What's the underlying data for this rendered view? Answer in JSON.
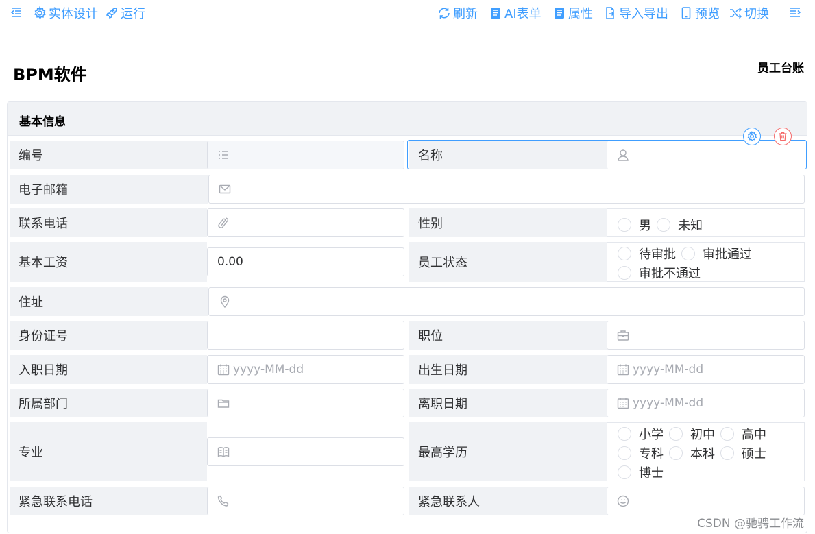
{
  "toolbar": {
    "entity_design": "实体设计",
    "run": "运行",
    "refresh": "刷新",
    "ai_form": "AI表单",
    "properties": "属性",
    "import_export": "导入导出",
    "preview": "预览",
    "switch": "切换",
    "accent_color": "#409eff"
  },
  "page": {
    "title": "BPM软件",
    "form_name": "员工台账"
  },
  "section": {
    "title": "基本信息"
  },
  "fields": {
    "number": {
      "label": "编号",
      "icon": "list-icon"
    },
    "name": {
      "label": "名称",
      "icon": "user-icon"
    },
    "email": {
      "label": "电子邮箱",
      "icon": "mail-icon"
    },
    "phone": {
      "label": "联系电话",
      "icon": "phone-icon"
    },
    "gender": {
      "label": "性别",
      "options": [
        "男",
        "未知"
      ]
    },
    "salary": {
      "label": "基本工资",
      "value": "0.00"
    },
    "status": {
      "label": "员工状态",
      "options": [
        "待审批",
        "审批通过",
        "审批不通过"
      ]
    },
    "address": {
      "label": "住址",
      "icon": "location-icon"
    },
    "id_card": {
      "label": "身份证号"
    },
    "position": {
      "label": "职位",
      "icon": "briefcase-icon"
    },
    "hire_date": {
      "label": "入职日期",
      "placeholder": "yyyy-MM-dd"
    },
    "birth_date": {
      "label": "出生日期",
      "placeholder": "yyyy-MM-dd"
    },
    "department": {
      "label": "所属部门",
      "icon": "folder-icon"
    },
    "leave_date": {
      "label": "离职日期",
      "placeholder": "yyyy-MM-dd"
    },
    "major": {
      "label": "专业",
      "icon": "book-icon"
    },
    "education": {
      "label": "最高学历",
      "options": [
        "小学",
        "初中",
        "高中",
        "专科",
        "本科",
        "硕士",
        "博士"
      ]
    },
    "emergency_phone": {
      "label": "紧急联系电话",
      "icon": "telephone-icon"
    },
    "emergency_contact": {
      "label": "紧急联系人",
      "icon": "smile-icon"
    }
  },
  "watermark": "CSDN @驰骋工作流"
}
